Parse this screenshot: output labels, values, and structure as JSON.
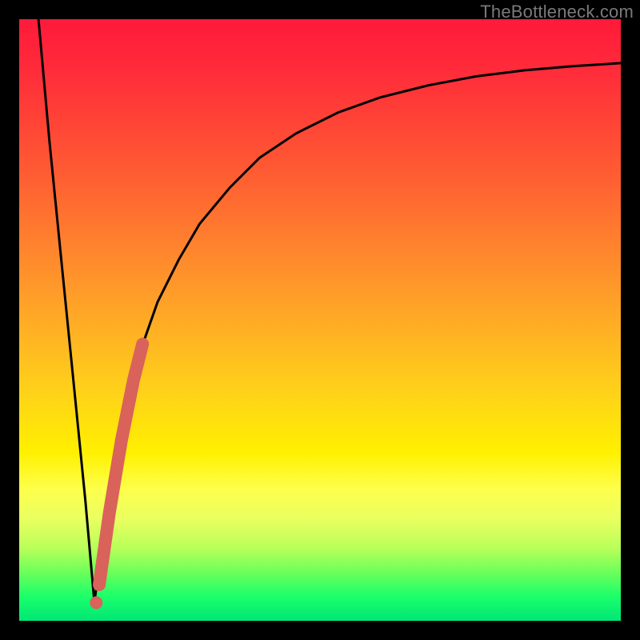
{
  "watermark": "TheBottleneck.com",
  "chart_data": {
    "type": "line",
    "title": "",
    "xlabel": "",
    "ylabel": "",
    "xlim": [
      0,
      100
    ],
    "ylim": [
      0,
      100
    ],
    "series": [
      {
        "name": "curve-left",
        "x": [
          3.2,
          5.0,
          7.0,
          9.0,
          11.0,
          12.5
        ],
        "values": [
          100,
          80,
          60,
          40,
          20,
          3
        ]
      },
      {
        "name": "curve-right",
        "x": [
          12.5,
          14.0,
          16.0,
          18.0,
          20.2,
          23.0,
          26.5,
          30.0,
          35.0,
          40.0,
          46.0,
          53.0,
          60.0,
          68.0,
          76.0,
          84.0,
          92.0,
          100.0
        ],
        "values": [
          3,
          15,
          27,
          37,
          45,
          53,
          60,
          66,
          72,
          77,
          81,
          84.5,
          87,
          89,
          90.5,
          91.5,
          92.2,
          92.7
        ]
      }
    ],
    "annotation": {
      "name": "highlight-segment",
      "color": "#d9625b",
      "x": [
        13.3,
        15.0,
        17.0,
        19.0,
        20.5
      ],
      "values": [
        6,
        18,
        30,
        40,
        46
      ]
    },
    "end_dot": {
      "x": 12.8,
      "y": 3,
      "color": "#d9625b"
    },
    "grid": false,
    "legend": null
  },
  "colors": {
    "curve": "#000000",
    "highlight": "#d9625b",
    "frame": "#000000"
  }
}
